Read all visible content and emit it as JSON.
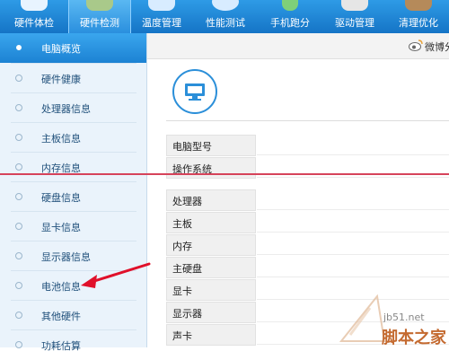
{
  "toolbar": {
    "tabs": [
      {
        "label": "硬件体检"
      },
      {
        "label": "硬件检测",
        "active": true
      },
      {
        "label": "温度管理"
      },
      {
        "label": "性能测试"
      },
      {
        "label": "手机跑分"
      },
      {
        "label": "驱动管理"
      },
      {
        "label": "清理优化"
      }
    ]
  },
  "sidebar": {
    "items": [
      {
        "label": "电脑概览",
        "active": true
      },
      {
        "label": "硬件健康"
      },
      {
        "label": "处理器信息"
      },
      {
        "label": "主板信息"
      },
      {
        "label": "内存信息"
      },
      {
        "label": "硬盘信息"
      },
      {
        "label": "显卡信息"
      },
      {
        "label": "显示器信息"
      },
      {
        "label": "电池信息"
      },
      {
        "label": "其他硬件"
      },
      {
        "label": "功耗估算"
      }
    ]
  },
  "share": {
    "label": "微博分"
  },
  "info_rows_top": [
    {
      "label": "电脑型号"
    },
    {
      "label": "操作系统"
    }
  ],
  "info_rows": [
    {
      "label": "处理器"
    },
    {
      "label": "主板"
    },
    {
      "label": "内存"
    },
    {
      "label": "主硬盘"
    },
    {
      "label": "显卡"
    },
    {
      "label": "显示器"
    },
    {
      "label": "声卡"
    }
  ],
  "watermark": {
    "site": "jb51.net",
    "name": "脚本之家"
  },
  "colors": {
    "accent": "#1c82d3",
    "annotation": "#d6435a"
  }
}
